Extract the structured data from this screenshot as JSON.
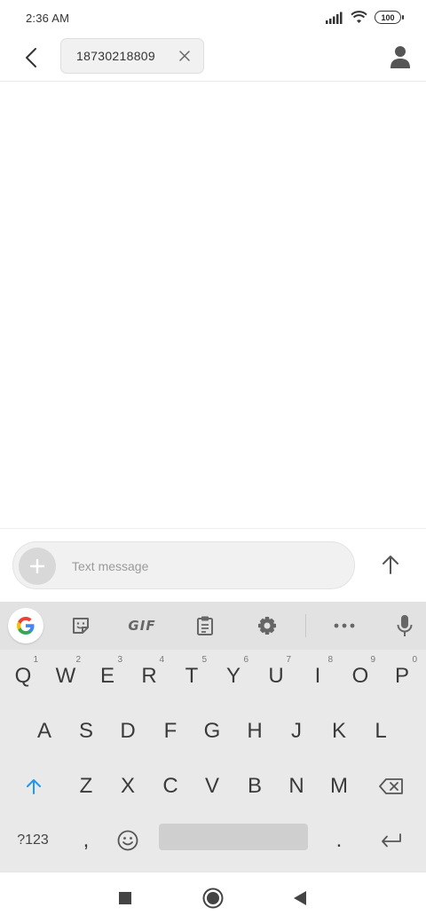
{
  "status_bar": {
    "time": "2:36 AM",
    "battery": "100",
    "icons": [
      "signal-icon",
      "wifi-icon",
      "battery-icon"
    ]
  },
  "header": {
    "back_icon": "back-arrow-icon",
    "recipient": "18730218809",
    "chip_close_icon": "close-icon",
    "contact_icon": "person-icon"
  },
  "compose": {
    "placeholder": "Text message",
    "attach_icon": "plus-icon",
    "send_icon": "arrow-up-icon"
  },
  "keyboard": {
    "toolbar": {
      "google_icon": "google-icon",
      "sticker_icon": "sticker-icon",
      "gif_label": "GIF",
      "clipboard_icon": "clipboard-icon",
      "settings_icon": "gear-icon",
      "more_icon": "more-icon",
      "mic_icon": "microphone-icon"
    },
    "row1": [
      {
        "label": "Q",
        "hint": "1"
      },
      {
        "label": "W",
        "hint": "2"
      },
      {
        "label": "E",
        "hint": "3"
      },
      {
        "label": "R",
        "hint": "4"
      },
      {
        "label": "T",
        "hint": "5"
      },
      {
        "label": "Y",
        "hint": "6"
      },
      {
        "label": "U",
        "hint": "7"
      },
      {
        "label": "I",
        "hint": "8"
      },
      {
        "label": "O",
        "hint": "9"
      },
      {
        "label": "P",
        "hint": "0"
      }
    ],
    "row2": [
      "A",
      "S",
      "D",
      "F",
      "G",
      "H",
      "J",
      "K",
      "L"
    ],
    "row3": [
      "Z",
      "X",
      "C",
      "V",
      "B",
      "N",
      "M"
    ],
    "row4": {
      "symbols_label": "?123",
      "comma": ",",
      "emoji_icon": "emoji-icon",
      "period": ".",
      "enter_icon": "enter-icon"
    },
    "shift_icon": "shift-icon",
    "backspace_icon": "backspace-icon",
    "accent_color": "#2196F3"
  },
  "nav_bar": {
    "recents_icon": "square-icon",
    "home_icon": "circle-icon",
    "back_icon": "triangle-back-icon"
  }
}
